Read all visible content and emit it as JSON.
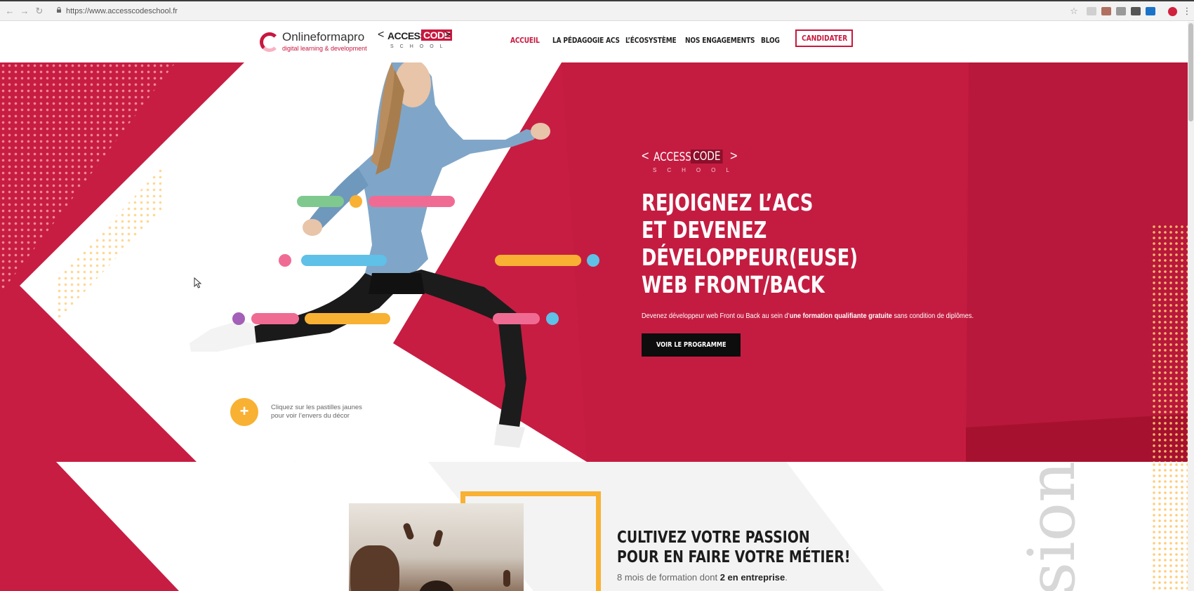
{
  "browser": {
    "url": "https://www.accesscodeschool.fr"
  },
  "header": {
    "brand1_name": "Onlineformapro",
    "brand1_tagline": "digital learning & development",
    "brand2_lt": "<",
    "brand2_access": "ACCESS",
    "brand2_code": "CODE",
    "brand2_gt": ">",
    "brand2_school": "SCHOOL",
    "menu": [
      {
        "label": "ACCUEIL",
        "active": true
      },
      {
        "label": "LA PÉDAGOGIE ACS",
        "active": false
      },
      {
        "label": "L’ÉCOSYSTÈME",
        "active": false
      },
      {
        "label": "NOS ENGAGEMENTS",
        "active": false
      },
      {
        "label": "BLOG",
        "active": false
      }
    ],
    "cta_label": "CANDIDATER"
  },
  "hero": {
    "logo_lt": "<",
    "logo_access": "ACCESS",
    "logo_code": "CODE",
    "logo_gt": ">",
    "logo_school": "SCHOOL",
    "title_lines": [
      "REJOIGNEZ L’ACS",
      "ET DEVENEZ",
      "DÉVELOPPEUR(EUSE)",
      "WEB FRONT/BACK"
    ],
    "subtitle_pre": "Devenez développeur web Front ou Back au sein d’",
    "subtitle_bold": "une formation qualifiante gratuite",
    "subtitle_post": " sans condition de diplômes.",
    "button_label": "VOIR LE PROGRAMME",
    "plus_symbol": "+",
    "hint_line1": "Cliquez sur les pastilles jaunes",
    "hint_line2": "pour voir l’envers du décor"
  },
  "section2": {
    "title_line1": "CULTIVEZ VOTRE PASSION",
    "title_line2": "POUR EN FAIRE VOTRE MÉTIER!",
    "sub_pre": "8 mois de formation dont ",
    "sub_bold": "2 en entreprise",
    "sub_post": ".",
    "vertical_word": "sion"
  },
  "colors": {
    "brand_red": "#c8173e",
    "accent_yellow": "#f8b133",
    "pill_green": "#7fc98f",
    "pill_pink": "#f06b93",
    "pill_blue": "#5fc0e8",
    "pill_purple": "#a45fb8"
  }
}
